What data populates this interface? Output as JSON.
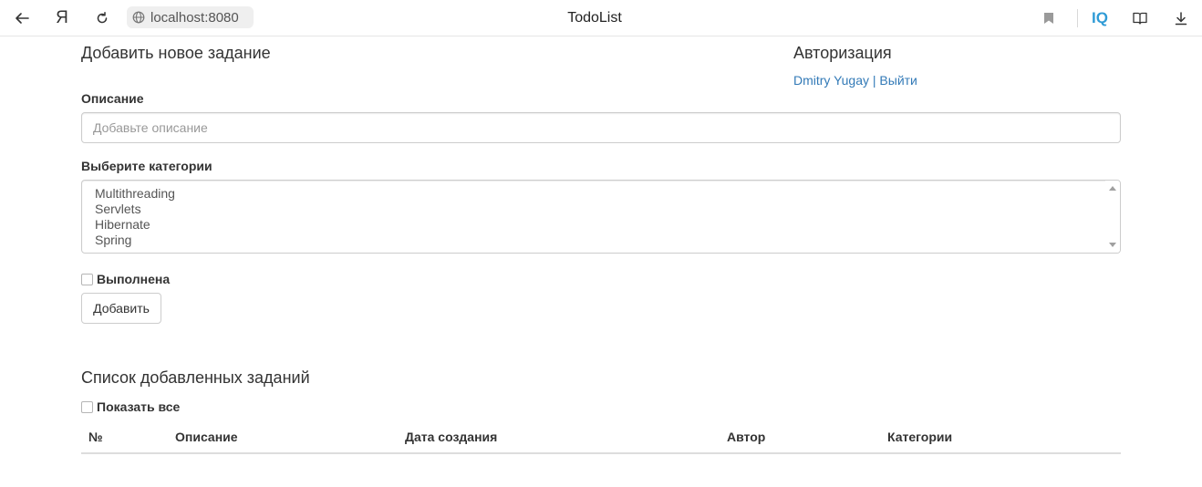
{
  "browser": {
    "ya_label": "Я",
    "url": "localhost:8080",
    "tab_title": "TodoList",
    "iq_label": "IQ"
  },
  "new_task": {
    "heading": "Добавить новое задание",
    "description_label": "Описание",
    "description_placeholder": "Добавьте описание",
    "description_value": "",
    "categories_label": "Выберите категории",
    "categories": [
      "Multithreading",
      "Servlets",
      "Hibernate",
      "Spring"
    ],
    "done_label": "Выполнена",
    "done_checked": false,
    "add_button": "Добавить"
  },
  "auth": {
    "heading": "Авторизация",
    "user_name": "Dmitry Yugay",
    "separator": " | ",
    "logout": "Выйти"
  },
  "task_list": {
    "heading": "Список добавленных заданий",
    "show_all_label": "Показать все",
    "show_all_checked": false,
    "columns": [
      "№",
      "Описание",
      "Дата создания",
      "Автор",
      "Категории"
    ],
    "rows": []
  },
  "colors": {
    "link": "#337ab7",
    "iq_brand": "#2f9bd6",
    "text": "#333333",
    "border": "#cccccc"
  }
}
